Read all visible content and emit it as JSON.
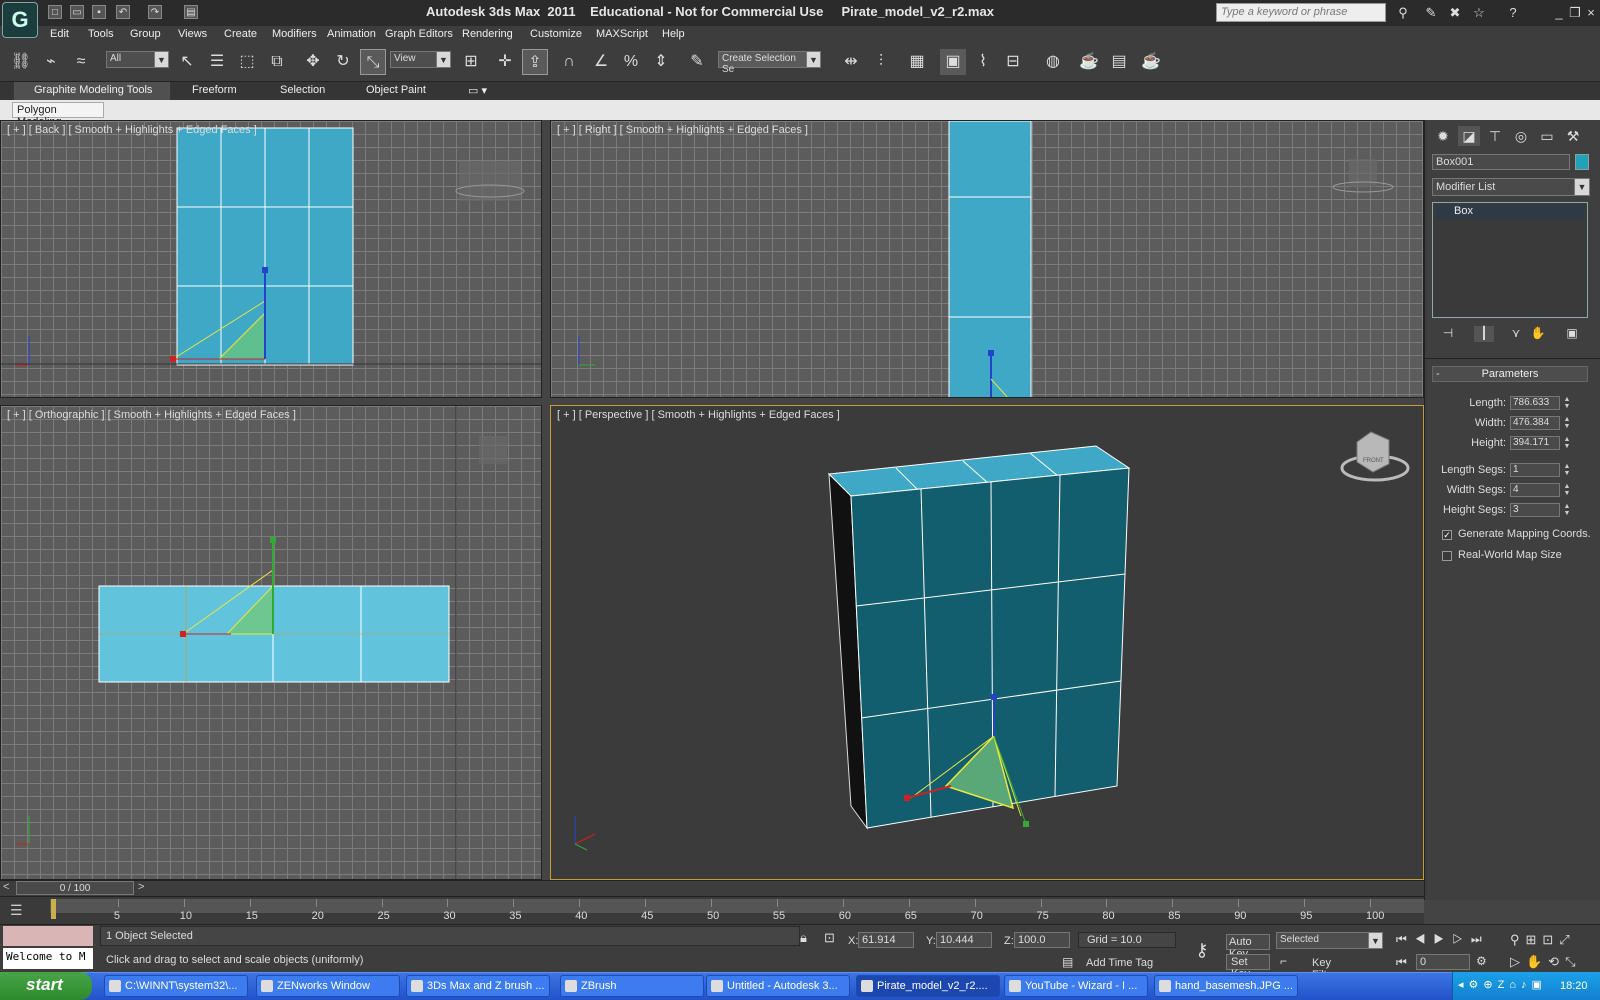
{
  "window": {
    "title": "Autodesk 3ds Max  2011    Educational - Not for Commercial Use     Pirate_model_v2_r2.max",
    "search_placeholder": "Type a keyword or phrase"
  },
  "menu": [
    "Edit",
    "Tools",
    "Group",
    "Views",
    "Create",
    "Modifiers",
    "Animation",
    "Graph Editors",
    "Rendering",
    "Customize",
    "MAXScript",
    "Help"
  ],
  "toolbar": {
    "filter_value": "All",
    "coord_value": "View",
    "selection_set": "Create Selection Se"
  },
  "ribbon": {
    "tabs": [
      "Graphite Modeling Tools",
      "Freeform",
      "Selection",
      "Object Paint"
    ],
    "panel": "Polygon Modeling"
  },
  "viewports": {
    "top_left": "[ + ] [ Back ] [ Smooth + Highlights + Edged Faces ]",
    "top_right": "[ + ] [ Right ] [ Smooth + Highlights + Edged Faces ]",
    "bottom_left": "[ + ] [ Orthographic ] [ Smooth + Highlights + Edged Faces ]",
    "perspective": "[ + ] [ Perspective ] [ Smooth + Highlights + Edged Faces ]",
    "viewcube_label": "FRONT"
  },
  "command_panel": {
    "object_name": "Box001",
    "object_color": "#1ea3b8",
    "modifier_list": "Modifier List",
    "stack_item": "Box",
    "rollout_title": "Parameters",
    "params": [
      {
        "label": "Length:",
        "value": "786.633"
      },
      {
        "label": "Width:",
        "value": "476.384"
      },
      {
        "label": "Height:",
        "value": "394.171"
      },
      {
        "label": "Length Segs:",
        "value": "1"
      },
      {
        "label": "Width Segs:",
        "value": "4"
      },
      {
        "label": "Height Segs:",
        "value": "3"
      }
    ],
    "generate_mapping": "Generate Mapping Coords.",
    "generate_mapping_checked": true,
    "real_world": "Real-World Map Size",
    "real_world_checked": false
  },
  "timeline": {
    "slider_label": "0 / 100",
    "ticks": [
      0,
      5,
      10,
      15,
      20,
      25,
      30,
      35,
      40,
      45,
      50,
      55,
      60,
      65,
      70,
      75,
      80,
      85,
      90,
      95,
      100
    ]
  },
  "status": {
    "welcome": "Welcome to M",
    "selected": "1 Object Selected",
    "prompt": "Click and drag to select and scale objects (uniformly)",
    "x_value": "61.914",
    "y_value": "10.444",
    "z_value": "100.0",
    "grid": "Grid = 10.0",
    "add_time_tag": "Add Time Tag",
    "auto_key": "Auto Key",
    "set_key": "Set Key",
    "selected_dropdown": "Selected",
    "key_filters": "Key Filters...",
    "frame_value": "0"
  },
  "taskbar": {
    "start": "start",
    "tasks": [
      "C:\\WINNT\\system32\\...",
      "ZENworks Window",
      "3Ds Max and Z brush ...",
      "ZBrush",
      "Untitled - Autodesk 3...",
      "Pirate_model_v2_r2....",
      "YouTube - Wizard - I ...",
      "hand_basemesh.JPG ..."
    ],
    "clock": "18:20"
  }
}
